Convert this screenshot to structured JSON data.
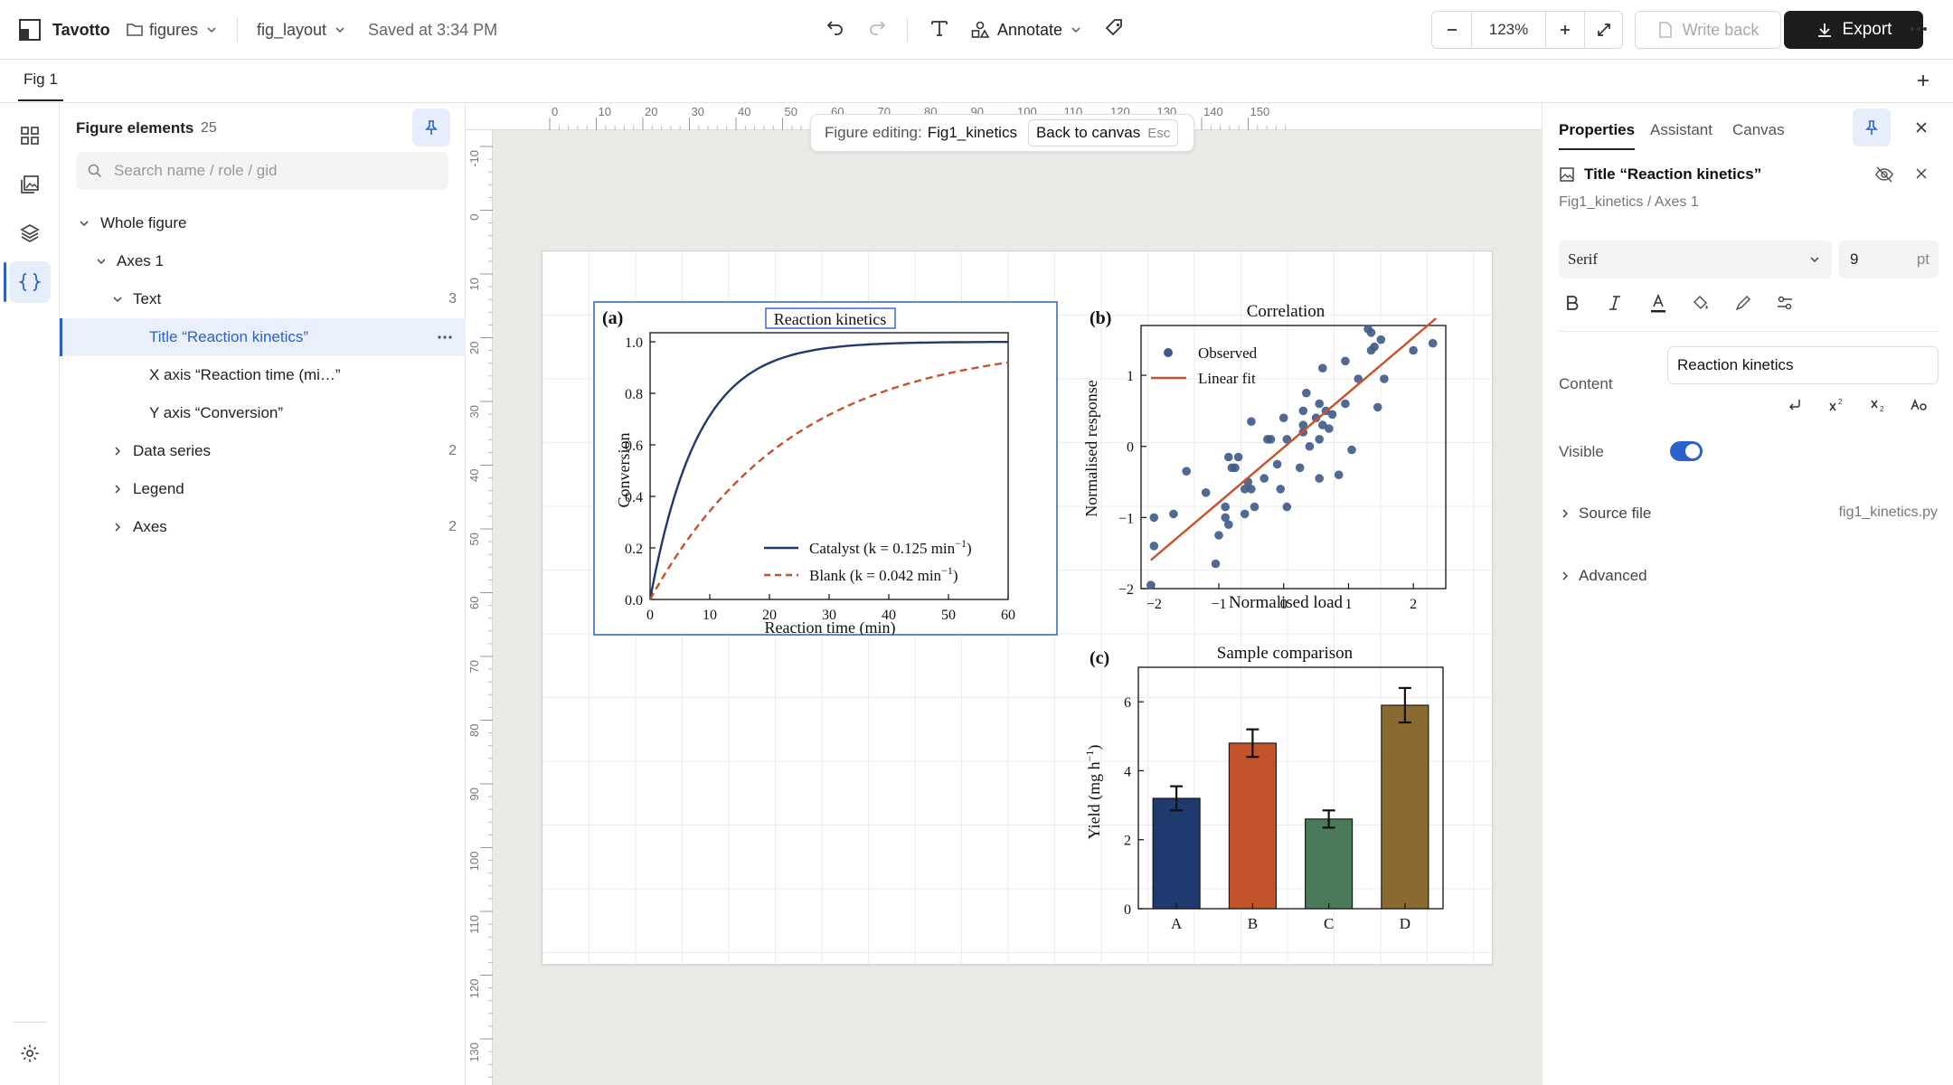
{
  "app": {
    "name": "Tavotto",
    "folder": "figures",
    "file": "fig_layout",
    "save_status": "Saved at 3:34 PM"
  },
  "toolbar": {
    "annotate_label": "Annotate",
    "zoom": "123%",
    "write_back_label": "Write back",
    "export_label": "Export"
  },
  "tabs": [
    {
      "label": "Fig 1"
    }
  ],
  "left_panel": {
    "title": "Figure elements",
    "count": "25",
    "search_placeholder": "Search name / role / gid",
    "tree": [
      {
        "label": "Whole figure",
        "count": ""
      },
      {
        "label": "Axes 1",
        "count": ""
      },
      {
        "label": "Text",
        "count": "3"
      },
      {
        "label": "Title “Reaction kinetics”",
        "count": ""
      },
      {
        "label": "X axis “Reaction time (mi…”",
        "count": ""
      },
      {
        "label": "Y axis “Conversion”",
        "count": ""
      },
      {
        "label": "Data series",
        "count": "2"
      },
      {
        "label": "Legend",
        "count": ""
      },
      {
        "label": "Axes",
        "count": "2"
      }
    ]
  },
  "canvas": {
    "banner_prefix": "Figure editing:",
    "banner_name": "Fig1_kinetics",
    "back_label": "Back to canvas",
    "back_key": "Esc",
    "ruler_x": [
      "0",
      "10",
      "20",
      "30",
      "40",
      "50",
      "60",
      "70",
      "80",
      "90",
      "100",
      "110",
      "120",
      "130",
      "140",
      "150"
    ],
    "ruler_y": [
      "-10",
      "0",
      "10",
      "20",
      "30",
      "40",
      "50",
      "60",
      "70",
      "80",
      "90",
      "100",
      "110",
      "120",
      "130"
    ]
  },
  "figure": {
    "panel_a": {
      "tag": "(a)",
      "title": "Reaction kinetics",
      "ylabel": "Conversion",
      "xlabel": "Reaction time (min)",
      "xticks": [
        "0",
        "10",
        "20",
        "30",
        "40",
        "50",
        "60"
      ],
      "yticks": [
        "0.0",
        "0.2",
        "0.4",
        "0.6",
        "0.8",
        "1.0"
      ],
      "legend_catalyst": "Catalyst (k = 0.125 min",
      "legend_blank": "Blank (k = 0.042 min",
      "legend_sup": "−1",
      "legend_close": ")"
    },
    "panel_b": {
      "tag": "(b)",
      "title": "Correlation",
      "xlabel": "Normalised load",
      "ylabel": "Normalised response",
      "xticks": [
        "−2",
        "−1",
        "0",
        "1",
        "2"
      ],
      "yticks": [
        "−2",
        "−1",
        "0",
        "1"
      ],
      "legend_observed": "Observed",
      "legend_fit": "Linear fit"
    },
    "panel_c": {
      "tag": "(c)",
      "title": "Sample comparison",
      "ylabel_main": "Yield (mg h",
      "ylabel_sup": "−1",
      "ylabel_close": ")",
      "xticks": [
        "A",
        "B",
        "C",
        "D"
      ],
      "yticks": [
        "0",
        "2",
        "4",
        "6"
      ]
    }
  },
  "right_panel": {
    "tabs": [
      "Properties",
      "Assistant",
      "Canvas"
    ],
    "element_title": "Title “Reaction kinetics”",
    "breadcrumb": "Fig1_kinetics / Axes 1",
    "font_family": "Serif",
    "font_size": "9",
    "font_unit": "pt",
    "content_label": "Content",
    "content_value": "Reaction kinetics",
    "visible_label": "Visible",
    "visible": true,
    "source_label": "Source file",
    "source_value": "fig1_kinetics.py",
    "advanced_label": "Advanced"
  },
  "chart_data": [
    {
      "type": "line",
      "title": "Reaction kinetics",
      "xlabel": "Reaction time (min)",
      "ylabel": "Conversion",
      "xlim": [
        0,
        60
      ],
      "ylim": [
        0,
        1.0
      ],
      "series": [
        {
          "name": "Catalyst (k = 0.125 min−1)",
          "color": "#1f3a6e",
          "style": "solid",
          "x": [
            0,
            5,
            10,
            15,
            20,
            25,
            30,
            40,
            50,
            60
          ],
          "y": [
            0,
            0.46,
            0.71,
            0.85,
            0.92,
            0.96,
            0.98,
            0.99,
            1.0,
            1.0
          ]
        },
        {
          "name": "Blank (k = 0.042 min−1)",
          "color": "#c8522a",
          "style": "dashed",
          "x": [
            0,
            5,
            10,
            15,
            20,
            25,
            30,
            40,
            50,
            60
          ],
          "y": [
            0,
            0.19,
            0.34,
            0.47,
            0.57,
            0.65,
            0.72,
            0.81,
            0.88,
            0.92
          ]
        }
      ]
    },
    {
      "type": "scatter",
      "title": "Correlation",
      "xlabel": "Normalised load",
      "ylabel": "Normalised response",
      "xlim": [
        -2.2,
        2.5
      ],
      "ylim": [
        -2,
        1.7
      ],
      "series": [
        {
          "name": "Observed",
          "color": "#3d5a8a",
          "points": [
            [
              -2.05,
              -1.95
            ],
            [
              -2.0,
              -1.0
            ],
            [
              -2.0,
              -1.4
            ],
            [
              -1.7,
              -0.95
            ],
            [
              -1.5,
              -0.35
            ],
            [
              -1.2,
              -0.65
            ],
            [
              -1.05,
              -1.65
            ],
            [
              -1.0,
              -1.25
            ],
            [
              -0.9,
              -1.0
            ],
            [
              -0.9,
              -0.85
            ],
            [
              -0.85,
              -1.1
            ],
            [
              -0.85,
              -0.15
            ],
            [
              -0.8,
              -0.3
            ],
            [
              -0.75,
              -0.3
            ],
            [
              -0.7,
              -0.15
            ],
            [
              -0.6,
              -0.95
            ],
            [
              -0.6,
              -0.6
            ],
            [
              -0.55,
              -0.5
            ],
            [
              -0.5,
              -0.6
            ],
            [
              -0.5,
              0.35
            ],
            [
              -0.45,
              -0.85
            ],
            [
              -0.3,
              -0.45
            ],
            [
              -0.25,
              0.1
            ],
            [
              -0.2,
              0.1
            ],
            [
              -0.1,
              -0.25
            ],
            [
              -0.05,
              -0.6
            ],
            [
              0.0,
              0.4
            ],
            [
              0.05,
              -0.85
            ],
            [
              0.05,
              0.1
            ],
            [
              0.25,
              -0.3
            ],
            [
              0.3,
              0.2
            ],
            [
              0.3,
              0.3
            ],
            [
              0.3,
              0.5
            ],
            [
              0.35,
              0.75
            ],
            [
              0.4,
              0.0
            ],
            [
              0.5,
              0.4
            ],
            [
              0.55,
              0.1
            ],
            [
              0.55,
              0.6
            ],
            [
              0.55,
              -0.45
            ],
            [
              0.6,
              0.3
            ],
            [
              0.6,
              1.1
            ],
            [
              0.65,
              0.5
            ],
            [
              0.7,
              0.25
            ],
            [
              0.75,
              0.45
            ],
            [
              0.85,
              -0.4
            ],
            [
              0.95,
              1.2
            ],
            [
              0.95,
              0.6
            ],
            [
              1.05,
              -0.05
            ],
            [
              1.15,
              0.95
            ],
            [
              1.3,
              1.65
            ],
            [
              1.35,
              1.6
            ],
            [
              1.35,
              1.35
            ],
            [
              1.4,
              1.4
            ],
            [
              1.45,
              0.55
            ],
            [
              1.5,
              1.5
            ],
            [
              1.55,
              0.95
            ],
            [
              2.0,
              1.35
            ],
            [
              2.3,
              1.45
            ]
          ]
        },
        {
          "name": "Linear fit",
          "color": "#c8522a",
          "x": [
            -2.05,
            2.35
          ],
          "y": [
            -1.6,
            1.8
          ]
        }
      ]
    },
    {
      "type": "bar",
      "title": "Sample comparison",
      "ylabel": "Yield (mg h−1)",
      "ylim": [
        0,
        7
      ],
      "categories": [
        "A",
        "B",
        "C",
        "D"
      ],
      "values": [
        3.2,
        4.8,
        2.6,
        5.9
      ],
      "errors": [
        0.35,
        0.4,
        0.25,
        0.5
      ],
      "colors": [
        "#1f3a6e",
        "#c3532a",
        "#4a7a5a",
        "#8a6a30"
      ]
    }
  ]
}
